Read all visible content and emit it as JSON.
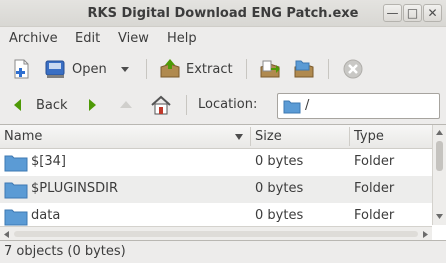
{
  "window": {
    "title": "RKS Digital Download ENG Patch.exe",
    "close_glyph": "✕",
    "minimize_glyph": "—",
    "maximize_glyph": "□"
  },
  "menu": [
    "Archive",
    "Edit",
    "View",
    "Help"
  ],
  "toolbar": {
    "open_label": "Open",
    "extract_label": "Extract",
    "icons": [
      "new-archive-icon",
      "open-icon",
      "dropdown-arrow-icon",
      "extract-icon",
      "add-files-icon",
      "add-folder-icon",
      "stop-icon"
    ]
  },
  "location": {
    "back_label": "Back",
    "location_label": "Location:",
    "path": "/"
  },
  "columns": {
    "name": "Name",
    "size": "Size",
    "type": "Type"
  },
  "files": [
    {
      "name": "$[34]",
      "size": "0 bytes",
      "type": "Folder"
    },
    {
      "name": "$PLUGINSDIR",
      "size": "0 bytes",
      "type": "Folder"
    },
    {
      "name": "data",
      "size": "0 bytes",
      "type": "Folder"
    }
  ],
  "status": "7 objects (0 bytes)",
  "colors": {
    "folder": "#5b9bd5",
    "nav_green": "#4e9a06"
  }
}
